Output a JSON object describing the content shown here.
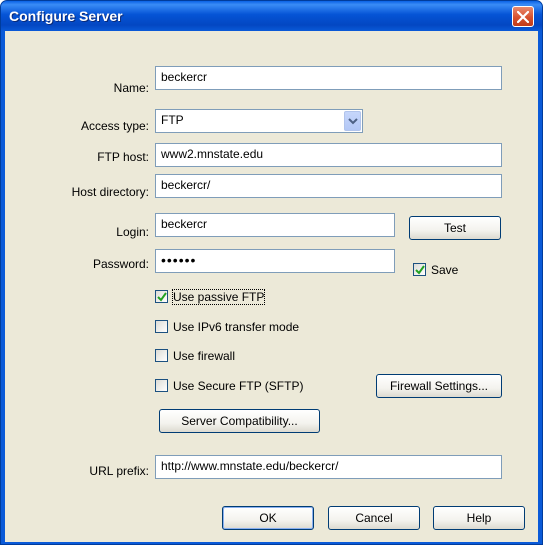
{
  "window": {
    "title": "Configure Server"
  },
  "labels": {
    "name": "Name:",
    "access_type": "Access type:",
    "ftp_host": "FTP host:",
    "host_directory": "Host directory:",
    "login": "Login:",
    "password": "Password:",
    "url_prefix": "URL prefix:"
  },
  "fields": {
    "name": "beckercr",
    "access_type": "FTP",
    "ftp_host": "www2.mnstate.edu",
    "host_directory": "beckercr/",
    "login": "beckercr",
    "password": "••••••",
    "url_prefix": "http://www.mnstate.edu/beckercr/"
  },
  "checkboxes": {
    "save": {
      "label": "Save",
      "checked": true
    },
    "passive_ftp": {
      "label": "Use passive FTP",
      "checked": true
    },
    "ipv6": {
      "label": "Use IPv6 transfer mode",
      "checked": false
    },
    "firewall": {
      "label": "Use firewall",
      "checked": false
    },
    "sftp": {
      "label": "Use Secure FTP (SFTP)",
      "checked": false
    }
  },
  "buttons": {
    "test": "Test",
    "firewall_settings": "Firewall Settings...",
    "server_compat": "Server Compatibility...",
    "ok": "OK",
    "cancel": "Cancel",
    "help": "Help"
  },
  "colors": {
    "title_bar": "#0554d6",
    "close_button": "#d6512e",
    "dialog_face": "#ece9d8",
    "field_border": "#7f9db9",
    "checkmark": "#21a121"
  }
}
